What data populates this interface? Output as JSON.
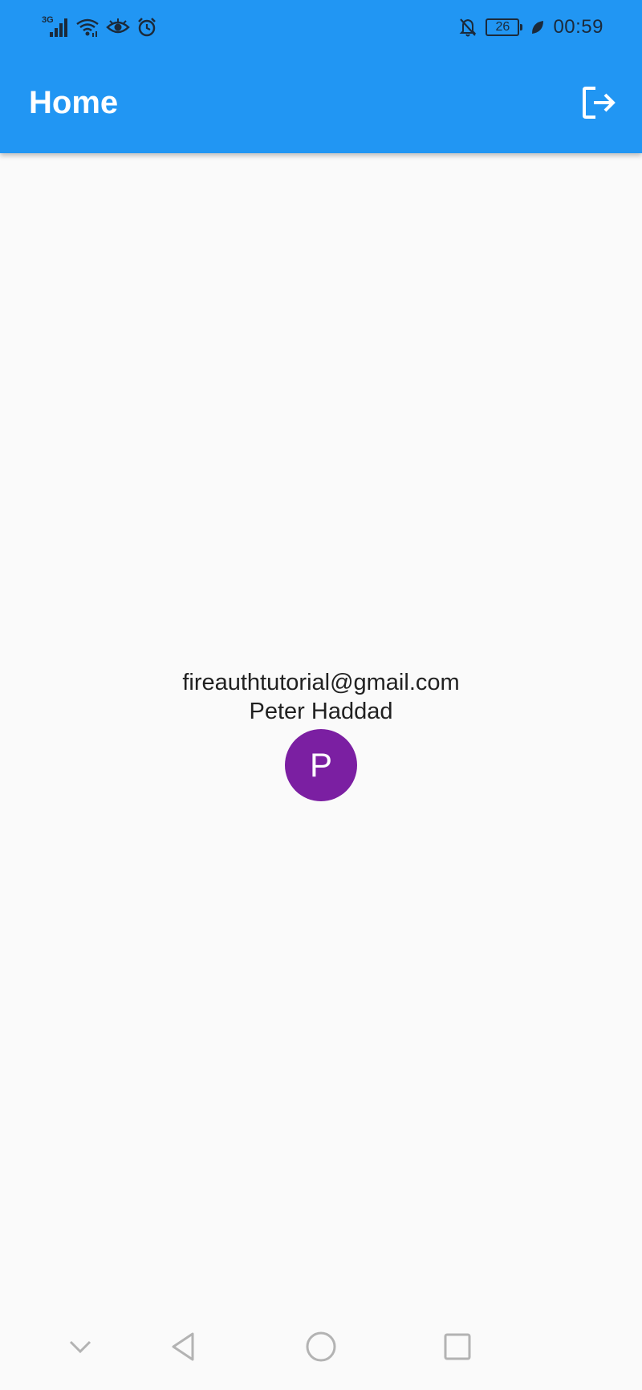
{
  "status_bar": {
    "network_type": "3G",
    "battery_level": "26",
    "time": "00:59",
    "left_icons": [
      "signal-icon",
      "wifi-icon",
      "eye-icon",
      "alarm-icon"
    ],
    "right_icons": [
      "notifications-off-icon",
      "battery-icon",
      "leaf-icon"
    ]
  },
  "app_bar": {
    "title": "Home",
    "action_icon": "logout-icon"
  },
  "profile": {
    "email": "fireauthtutorial@gmail.com",
    "name": "Peter Haddad",
    "avatar_initial": "P"
  },
  "nav_bar": {
    "buttons": [
      "collapse-icon",
      "back-icon",
      "home-icon",
      "recents-icon"
    ]
  },
  "colors": {
    "app_bar": "#2196f3",
    "avatar": "#7b1fa2",
    "background": "#fafafa",
    "text": "#212121"
  }
}
